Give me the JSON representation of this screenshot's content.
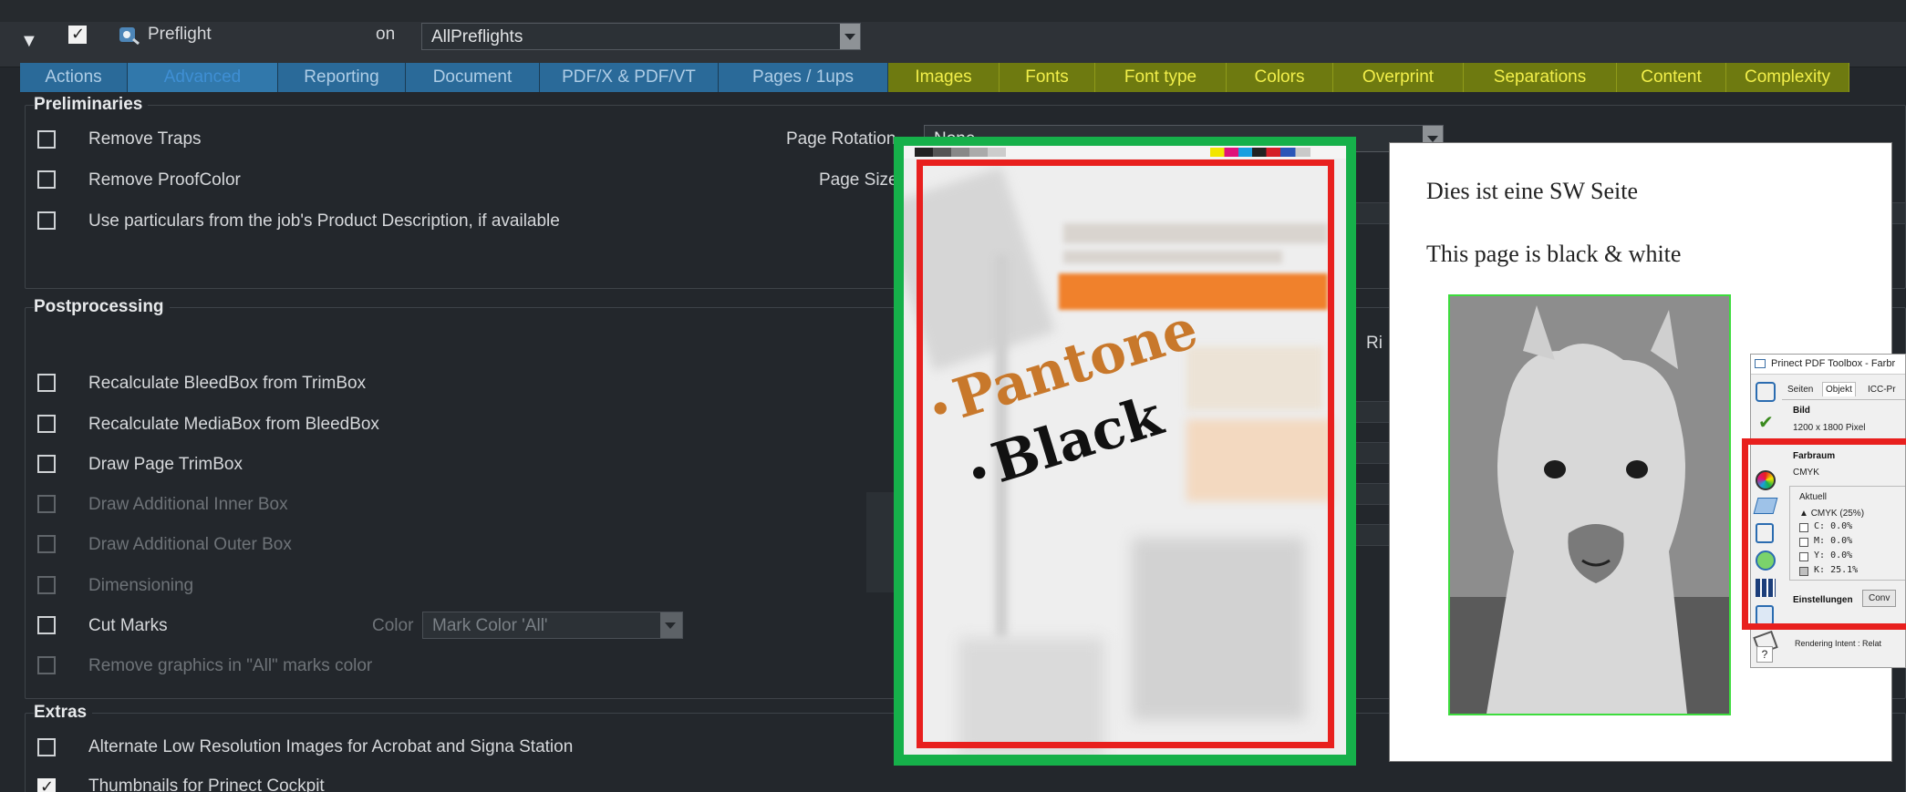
{
  "header": {
    "expand_glyph": "▼",
    "title": "Preflight",
    "on_label": "on",
    "profile_value": "AllPreflights"
  },
  "tabs": [
    {
      "label": "Actions",
      "style": "blue"
    },
    {
      "label": "Advanced",
      "style": "selected"
    },
    {
      "label": "Reporting",
      "style": "blue"
    },
    {
      "label": "Document",
      "style": "blue"
    },
    {
      "label": "PDF/X & PDF/VT",
      "style": "blue"
    },
    {
      "label": "Pages / 1ups",
      "style": "blue"
    },
    {
      "label": "Images",
      "style": "yellow"
    },
    {
      "label": "Fonts",
      "style": "yellow"
    },
    {
      "label": "Font type",
      "style": "yellow"
    },
    {
      "label": "Colors",
      "style": "yellow"
    },
    {
      "label": "Overprint",
      "style": "yellow"
    },
    {
      "label": "Separations",
      "style": "yellow"
    },
    {
      "label": "Content",
      "style": "yellow"
    },
    {
      "label": "Complexity",
      "style": "yellow"
    }
  ],
  "preliminaries": {
    "title": "Preliminaries",
    "items": [
      {
        "label": "Remove Traps",
        "checked": false,
        "enabled": true
      },
      {
        "label": "Remove ProofColor",
        "checked": false,
        "enabled": true
      },
      {
        "label": "Use particulars from the job's Product Description, if available",
        "checked": false,
        "enabled": true
      }
    ],
    "page_rotation_label": "Page Rotation",
    "page_rotation_value": "None",
    "page_size_label": "Page Size"
  },
  "postprocessing": {
    "title": "Postprocessing",
    "items": [
      {
        "label": "Recalculate BleedBox from TrimBox",
        "checked": false,
        "enabled": true
      },
      {
        "label": "Recalculate MediaBox from BleedBox",
        "checked": false,
        "enabled": true
      },
      {
        "label": "Draw Page TrimBox",
        "checked": false,
        "enabled": true
      },
      {
        "label": "Draw Additional Inner Box",
        "checked": false,
        "enabled": false
      },
      {
        "label": "Draw Additional Outer Box",
        "checked": false,
        "enabled": false
      },
      {
        "label": "Dimensioning",
        "checked": false,
        "enabled": false
      },
      {
        "label": "Cut Marks",
        "checked": false,
        "enabled": true
      },
      {
        "label": "Remove graphics in \"All\" marks color",
        "checked": false,
        "enabled": false
      }
    ],
    "color_label": "Color",
    "color_value": "Mark Color 'All'",
    "partial_right_label": "Ri"
  },
  "extras": {
    "title": "Extras",
    "items": [
      {
        "label": "Alternate Low Resolution Images for Acrobat and Signa Station",
        "checked": false,
        "enabled": true
      },
      {
        "label": "Thumbnails for Prinect Cockpit",
        "checked": true,
        "enabled": true
      }
    ]
  },
  "overlay_preview": {
    "bullet_1": "Pantone",
    "bullet_2": "Black",
    "bullet_glyph": "•",
    "colors": {
      "outer_frame": "#16b04a",
      "inner_frame": "#e8201e",
      "pantone_text": "#c8782b"
    }
  },
  "overlay_page": {
    "line_1": "Dies ist eine SW Seite",
    "line_2": "This page is black & white",
    "image_frame_color": "#3ddc3d"
  },
  "toolbox": {
    "title": "Prinect PDF Toolbox - Farbr",
    "tabs": [
      "Seiten",
      "Objekt",
      "ICC-Pr"
    ],
    "bild_label": "Bild",
    "pixel_size": "1200 x 1800 Pixel",
    "farbraum_label": "Farbraum",
    "farbraum_value": "CMYK",
    "aktuell_label": "Aktuell",
    "current_color": "CMYK (25%)",
    "channels": [
      {
        "name": "C:",
        "value": "0.0%"
      },
      {
        "name": "M:",
        "value": "0.0%"
      },
      {
        "name": "Y:",
        "value": "0.0%"
      },
      {
        "name": "K:",
        "value": "25.1%"
      }
    ],
    "einstellungen_label": "Einstellungen",
    "conv_button": "Conv",
    "rendering_intent": "Rendering Intent : Relat",
    "help_glyph": "?"
  }
}
